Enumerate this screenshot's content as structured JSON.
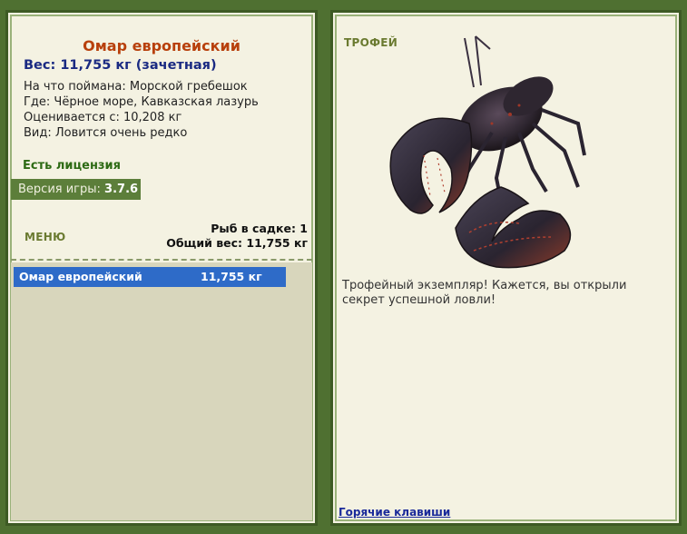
{
  "left_panel": {
    "fish_name": "Омар европейский",
    "weight_line": "Вес: 11,755 кг (зачетная)",
    "info": [
      "На что поймана: Морской гребешок",
      "Где: Чёрное море, Кавказская лазурь",
      "Оценивается с: 10,208 кг",
      "Вид: Ловится очень редко"
    ],
    "license": "Есть лицензия",
    "version_label": "Версия игры:",
    "version_value": "3.7.6",
    "menu_label": "МЕНЮ",
    "stats": {
      "fish_in_keepnet": "Рыб в садке: 1",
      "total_weight": "Общий вес: 11,755 кг"
    },
    "list": [
      {
        "name": "Омар европейский",
        "weight": "11,755 кг"
      }
    ]
  },
  "right_panel": {
    "title": "ТРОФЕЙ",
    "image_icon": "lobster-image",
    "description": "Трофейный экземпляр! Кажется, вы открыли секрет успешной ловли!",
    "hotkeys_link": "Горячие клавиши"
  },
  "colors": {
    "frame": "#4f7031",
    "panel_bg": "#f4f2e2",
    "title_orange": "#b8400c",
    "weight_blue": "#1a2a82",
    "license_green": "#2d6a14",
    "selected_row": "#2e6bc8",
    "list_bg": "#d8d6bc"
  }
}
